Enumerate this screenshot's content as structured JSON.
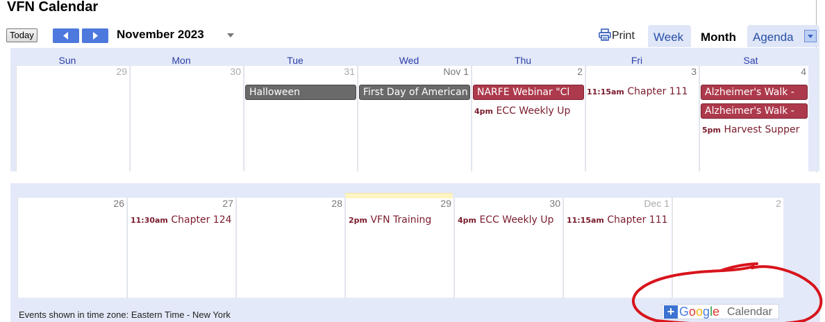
{
  "calendar": {
    "title": "VFN Calendar",
    "today_label": "Today",
    "month_label": "November 2023",
    "print_label": "Print",
    "views": [
      "Week",
      "Month",
      "Agenda"
    ],
    "active_view": "Month",
    "weekdays": [
      "Sun",
      "Mon",
      "Tue",
      "Wed",
      "Thu",
      "Fri",
      "Sat"
    ]
  },
  "week1": {
    "days": [
      "29",
      "30",
      "31",
      "Nov 1",
      "2",
      "3",
      "4"
    ],
    "events": {
      "halloween": "Halloween",
      "first_day": "First Day of American",
      "narfe": "NARFE Webinar \"Cl",
      "ecc_time": "4pm",
      "ecc_title": "ECC Weekly Up",
      "ch111_time": "11:15am",
      "ch111_title": "Chapter 111",
      "alz1": "Alzheimer's Walk -",
      "alz2": "Alzheimer's Walk -",
      "harvest_time": "5pm",
      "harvest_title": "Harvest Supper"
    }
  },
  "week2": {
    "days": [
      "26",
      "27",
      "28",
      "29",
      "30",
      "Dec 1",
      "2"
    ],
    "events": {
      "ch124_time": "11:30am",
      "ch124_title": "Chapter 124",
      "vfn_time": "2pm",
      "vfn_title": "VFN Training",
      "ecc_time": "4pm",
      "ecc_title": "ECC Weekly Up",
      "ch111_time": "11:15am",
      "ch111_title": "Chapter 111"
    }
  },
  "footer": {
    "timezone_text": "Events shown in time zone: Eastern Time - New York",
    "gcal_plus": "+",
    "gcal_google": [
      "G",
      "o",
      "o",
      "g",
      "l",
      "e"
    ],
    "gcal_calendar": "Calendar"
  },
  "colors": {
    "accent_blue": "#4d78dd",
    "weekday_text": "#2c3ea8",
    "frame_bg": "#e3e9f8",
    "all_day_gray": "#6a6a6a",
    "all_day_red": "#ad3a4c",
    "timed_text": "#7a1b2b",
    "today_highlight": "#fff5c4",
    "annotation_red": "#d8141c"
  }
}
